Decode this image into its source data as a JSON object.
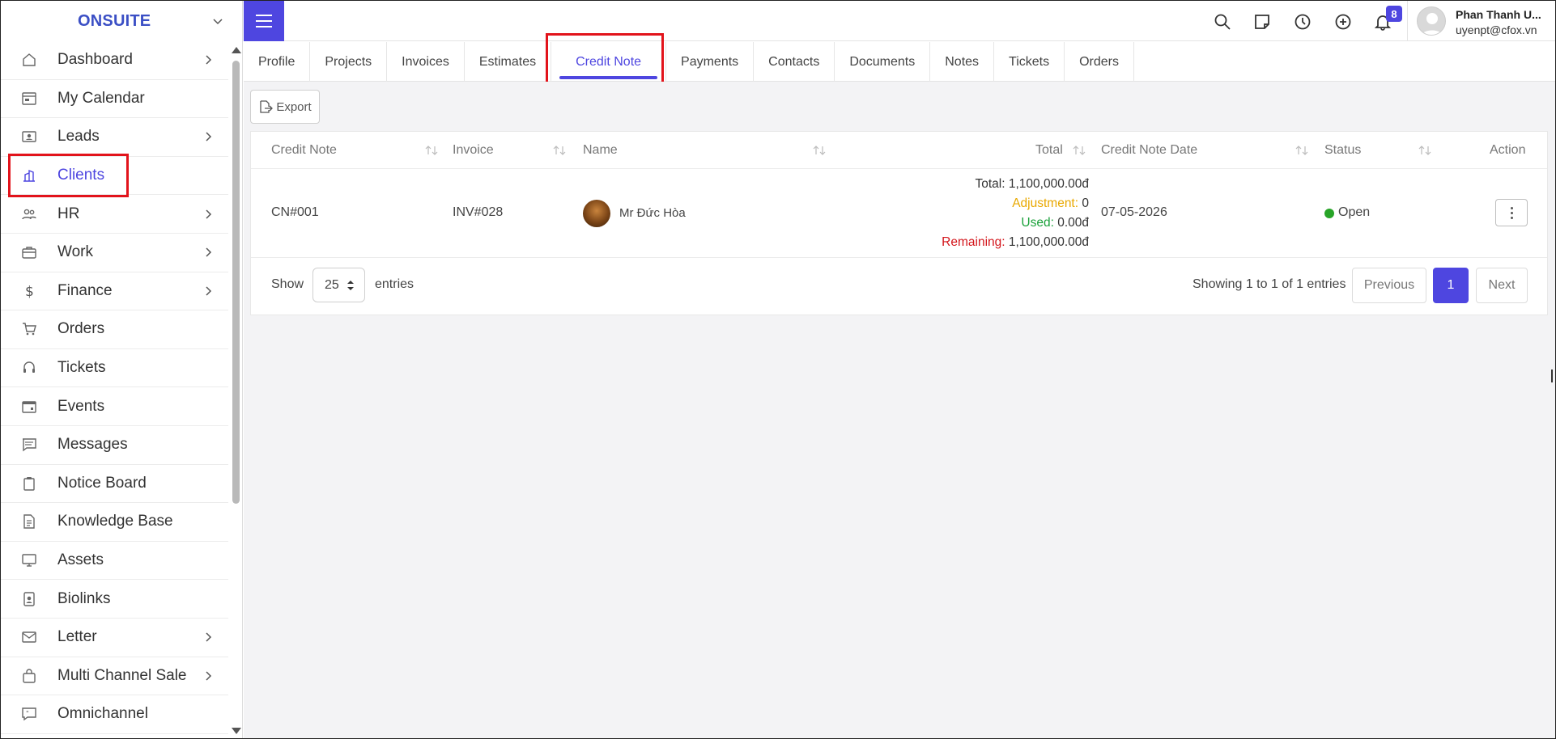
{
  "brand": {
    "name": "ONSUITE"
  },
  "sidebar": {
    "items": [
      {
        "label": "Dashboard",
        "icon": "home-icon",
        "has_children": true
      },
      {
        "label": "My Calendar",
        "icon": "calendar-icon",
        "has_children": false
      },
      {
        "label": "Leads",
        "icon": "contact-card-icon",
        "has_children": true
      },
      {
        "label": "Clients",
        "icon": "building-icon",
        "has_children": false,
        "active": true
      },
      {
        "label": "HR",
        "icon": "people-icon",
        "has_children": true
      },
      {
        "label": "Work",
        "icon": "briefcase-icon",
        "has_children": true
      },
      {
        "label": "Finance",
        "icon": "dollar-icon",
        "has_children": true
      },
      {
        "label": "Orders",
        "icon": "cart-icon",
        "has_children": false
      },
      {
        "label": "Tickets",
        "icon": "headset-icon",
        "has_children": false
      },
      {
        "label": "Events",
        "icon": "event-calendar-icon",
        "has_children": false
      },
      {
        "label": "Messages",
        "icon": "message-icon",
        "has_children": false
      },
      {
        "label": "Notice Board",
        "icon": "clipboard-icon",
        "has_children": false
      },
      {
        "label": "Knowledge Base",
        "icon": "document-icon",
        "has_children": false
      },
      {
        "label": "Assets",
        "icon": "monitor-icon",
        "has_children": false
      },
      {
        "label": "Biolinks",
        "icon": "id-badge-icon",
        "has_children": false
      },
      {
        "label": "Letter",
        "icon": "envelope-icon",
        "has_children": true
      },
      {
        "label": "Multi Channel Sale",
        "icon": "shopping-bag-icon",
        "has_children": true
      },
      {
        "label": "Omnichannel",
        "icon": "chat-bubble-icon",
        "has_children": false
      }
    ]
  },
  "header": {
    "notification_count": "8",
    "user": {
      "name": "Phan Thanh U...",
      "email": "uyenpt@cfox.vn"
    }
  },
  "tabs": [
    {
      "label": "Profile"
    },
    {
      "label": "Projects"
    },
    {
      "label": "Invoices"
    },
    {
      "label": "Estimates"
    },
    {
      "label": "Credit Note",
      "active": true
    },
    {
      "label": "Payments"
    },
    {
      "label": "Contacts"
    },
    {
      "label": "Documents"
    },
    {
      "label": "Notes"
    },
    {
      "label": "Tickets"
    },
    {
      "label": "Orders"
    }
  ],
  "toolbar": {
    "export_label": "Export"
  },
  "table": {
    "columns": {
      "credit_note": "Credit Note",
      "invoice": "Invoice",
      "name": "Name",
      "total": "Total",
      "credit_note_date": "Credit Note Date",
      "status": "Status",
      "action": "Action"
    },
    "rows": [
      {
        "credit_note": "CN#001",
        "invoice": "INV#028",
        "name": "Mr Đức Hòa",
        "total_label": "Total:",
        "total_value": "1,100,000.00đ",
        "adjustment_label": "Adjustment:",
        "adjustment_value": "0",
        "used_label": "Used:",
        "used_value": "0.00đ",
        "remaining_label": "Remaining:",
        "remaining_value": "1,100,000.00đ",
        "date": "07-05-2026",
        "status": "Open",
        "status_color": "#28a428"
      }
    ]
  },
  "footer": {
    "show_label": "Show",
    "page_length": "25",
    "entries_label": "entries",
    "info": "Showing 1 to 1 of 1 entries",
    "previous_label": "Previous",
    "current_page": "1",
    "next_label": "Next"
  },
  "colors": {
    "accent": "#4e46e0",
    "brand": "#3b4fc5",
    "highlight": "#e2131b"
  }
}
